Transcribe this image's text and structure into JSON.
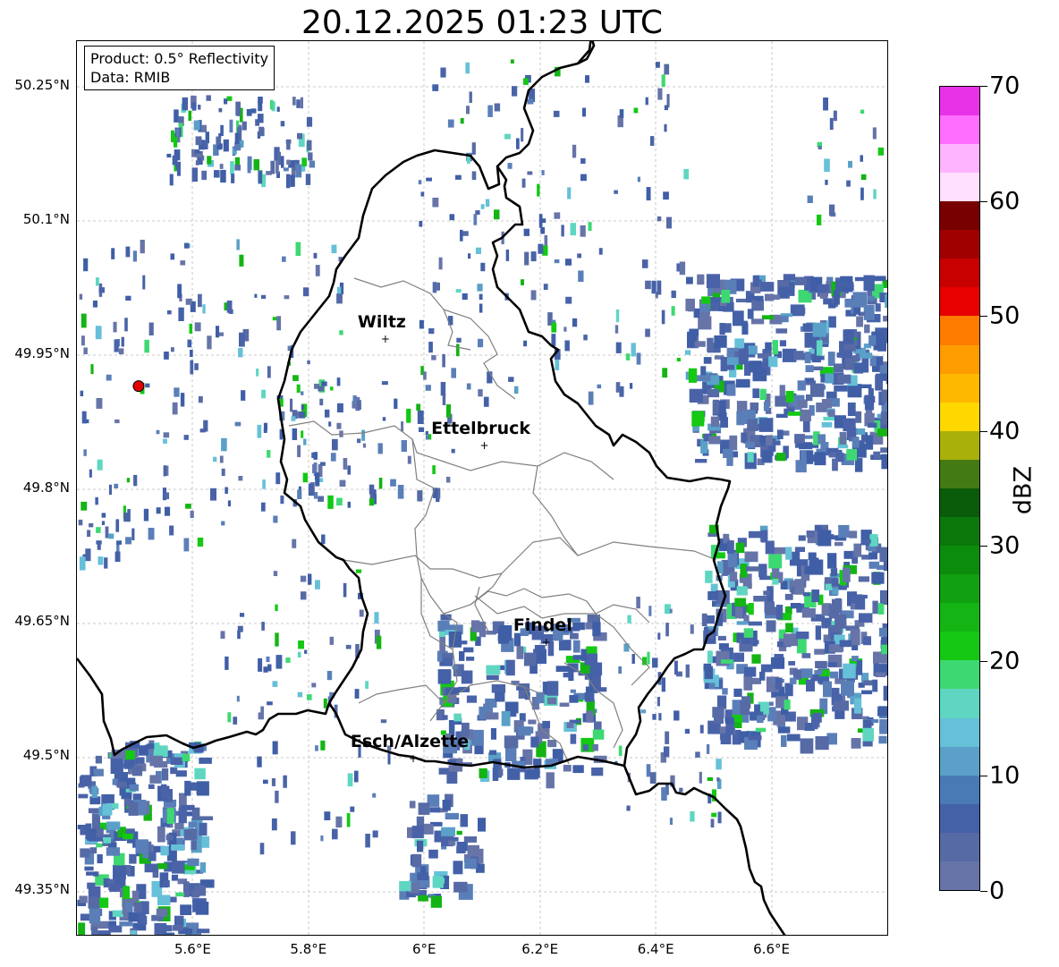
{
  "title": "20.12.2025 01:23 UTC",
  "info_box": {
    "product": "Product: 0.5° Reflectivity",
    "source": "Data: RMIB"
  },
  "lat_labels": [
    "50.25°N",
    "50.1°N",
    "49.95°N",
    "49.8°N",
    "49.65°N",
    "49.5°N",
    "49.35°N"
  ],
  "lon_labels": [
    "5.6°E",
    "5.8°E",
    "6°E",
    "6.2°E",
    "6.4°E",
    "6.6°E"
  ],
  "cities": [
    {
      "name": "Wiltz",
      "lon": 5.933,
      "lat": 49.966
    },
    {
      "name": "Ettelbruck",
      "lon": 6.104,
      "lat": 49.847
    },
    {
      "name": "Findel",
      "lon": 6.211,
      "lat": 49.626
    },
    {
      "name": "Esch/Alzette",
      "lon": 5.981,
      "lat": 49.496
    }
  ],
  "radar_site": {
    "lon": 5.505,
    "lat": 49.914,
    "color": "#e00000"
  },
  "colorbar": {
    "unit": "dBZ",
    "tick_labels": [
      "0",
      "10",
      "20",
      "30",
      "40",
      "50",
      "60",
      "70"
    ],
    "min": 0,
    "max": 70,
    "step": 2.5,
    "colors": [
      "#6674a8",
      "#566aa6",
      "#4461a8",
      "#4a7ab6",
      "#5aa0c8",
      "#66c0d8",
      "#5fd6c2",
      "#3ed872",
      "#14c814",
      "#14b414",
      "#10a010",
      "#0c8c0c",
      "#0c780c",
      "#0a5c0a",
      "#447a14",
      "#aab00a",
      "#ffd800",
      "#ffb800",
      "#ff9c00",
      "#ff7c00",
      "#e80000",
      "#c80000",
      "#a00000",
      "#780000",
      "#ffe0ff",
      "#ffb4ff",
      "#ff6eff",
      "#e832e8"
    ]
  },
  "map_extent": {
    "lon_min": 5.4,
    "lon_max": 6.8,
    "lat_min": 49.3,
    "lat_max": 50.3
  }
}
